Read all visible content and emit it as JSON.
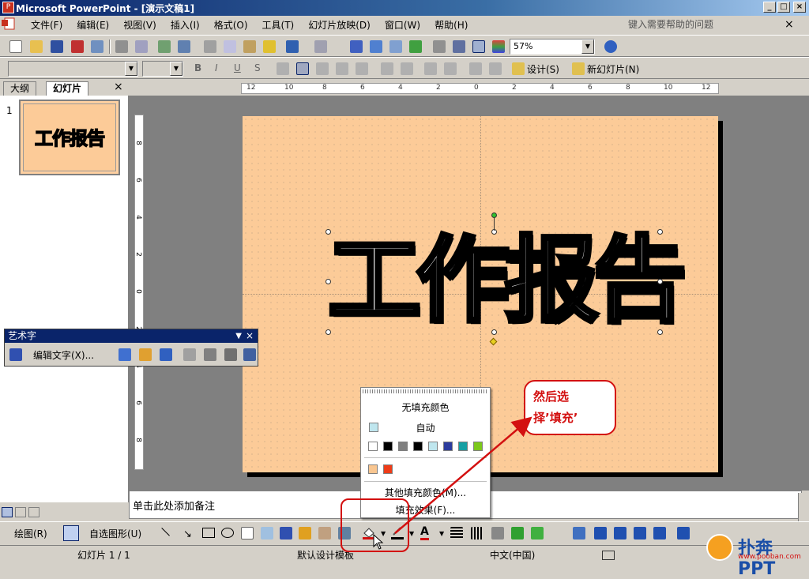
{
  "window": {
    "title": "Microsoft PowerPoint - [演示文稿1]",
    "controls": [
      "_",
      "□",
      "×"
    ]
  },
  "menu": {
    "items": [
      "文件(F)",
      "编辑(E)",
      "视图(V)",
      "插入(I)",
      "格式(O)",
      "工具(T)",
      "幻灯片放映(D)",
      "窗口(W)",
      "帮助(H)"
    ],
    "help_placeholder": "键入需要帮助的问题"
  },
  "standard_toolbar": {
    "zoom": "57%"
  },
  "formatting_toolbar": {
    "font": "",
    "size": "",
    "design_label": "设计(S)",
    "new_slide_label": "新幻灯片(N)"
  },
  "left_panel": {
    "tabs": [
      "大纲",
      "幻灯片"
    ],
    "close_glyph": "×",
    "slide_number": "1",
    "thumb_text": "工作报告"
  },
  "ruler": {
    "h_ticks": [
      "12",
      "10",
      "8",
      "6",
      "4",
      "2",
      "0",
      "2",
      "4",
      "6",
      "8",
      "10",
      "12"
    ],
    "v_ticks": [
      "8",
      "6",
      "4",
      "2",
      "0",
      "2",
      "4",
      "6",
      "8"
    ]
  },
  "slide": {
    "wordart_text": "工作报告",
    "background_color": "#fccb98"
  },
  "wordart_toolbar": {
    "title": "艺术字",
    "edit_text_label": "编辑文字(X)..."
  },
  "fill_menu": {
    "no_fill": "无填充颜色",
    "auto": "自动",
    "swatches_row1": [
      "#ffffff",
      "#000000",
      "#808080",
      "#000000",
      "#bfe6ee",
      "#2c3c9e",
      "#16a0a4",
      "#7cc81c"
    ],
    "swatches_row2": [
      "#f9c690",
      "#ee3c18"
    ],
    "more_colors": "其他填充颜色(M)...",
    "fill_effects": "填充效果(F)..."
  },
  "callout": {
    "line1": "然后选",
    "line2": "择’填充’"
  },
  "notes": {
    "placeholder": "单击此处添加备注"
  },
  "drawing_toolbar": {
    "draw_label": "绘图(R)",
    "autoshapes_label": "自选图形(U)"
  },
  "status_bar": {
    "slide_info": "幻灯片 1 / 1",
    "template": "默认设计模板",
    "language": "中文(中国)"
  },
  "watermark": {
    "brand": "扑奔PPT",
    "url": "www.pooban.com"
  },
  "colors": {
    "accent": "#d31010",
    "title_bar": "#0a246a"
  }
}
